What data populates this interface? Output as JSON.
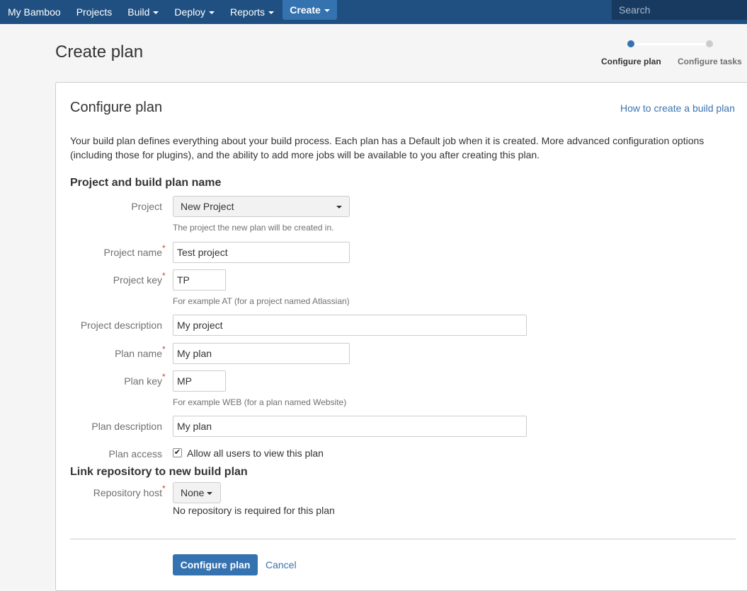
{
  "nav": {
    "items": [
      {
        "label": "My Bamboo",
        "has_caret": false
      },
      {
        "label": "Projects",
        "has_caret": false
      },
      {
        "label": "Build",
        "has_caret": true
      },
      {
        "label": "Deploy",
        "has_caret": true
      },
      {
        "label": "Reports",
        "has_caret": true
      }
    ],
    "create_label": "Create",
    "search_placeholder": "Search",
    "bg_color": "#205081",
    "accent_color": "#3572b0"
  },
  "header": {
    "title": "Create plan",
    "steps": [
      {
        "label": "Configure plan",
        "state": "active"
      },
      {
        "label": "Configure tasks",
        "state": "inactive"
      }
    ]
  },
  "panel": {
    "title": "Configure plan",
    "help_link": "How to create a build plan",
    "intro": "Your build plan defines everything about your build process. Each plan has a Default job when it is created. More advanced configuration options (including those for plugins), and the ability to add more jobs will be available to you after creating this plan.",
    "section_names": "Project and build plan name",
    "section_repo": "Link repository to new build plan"
  },
  "form": {
    "project": {
      "label": "Project",
      "value": "New Project",
      "hint": "The project the new plan will be created in."
    },
    "project_name": {
      "label": "Project name",
      "value": "Test project",
      "required": true
    },
    "project_key": {
      "label": "Project key",
      "value": "TP",
      "hint": "For example AT (for a project named Atlassian)",
      "required": true
    },
    "project_description": {
      "label": "Project description",
      "value": "My project"
    },
    "plan_name": {
      "label": "Plan name",
      "value": "My plan",
      "required": true
    },
    "plan_key": {
      "label": "Plan key",
      "value": "MP",
      "hint": "For example WEB (for a plan named Website)",
      "required": true
    },
    "plan_description": {
      "label": "Plan description",
      "value": "My plan"
    },
    "plan_access": {
      "label": "Plan access",
      "checkbox_label": "Allow all users to view this plan",
      "checked": true
    },
    "repository_host": {
      "label": "Repository host",
      "value": "None",
      "note": "No repository is required for this plan",
      "required": true
    },
    "required_marker": "*"
  },
  "actions": {
    "submit": "Configure plan",
    "cancel": "Cancel"
  }
}
